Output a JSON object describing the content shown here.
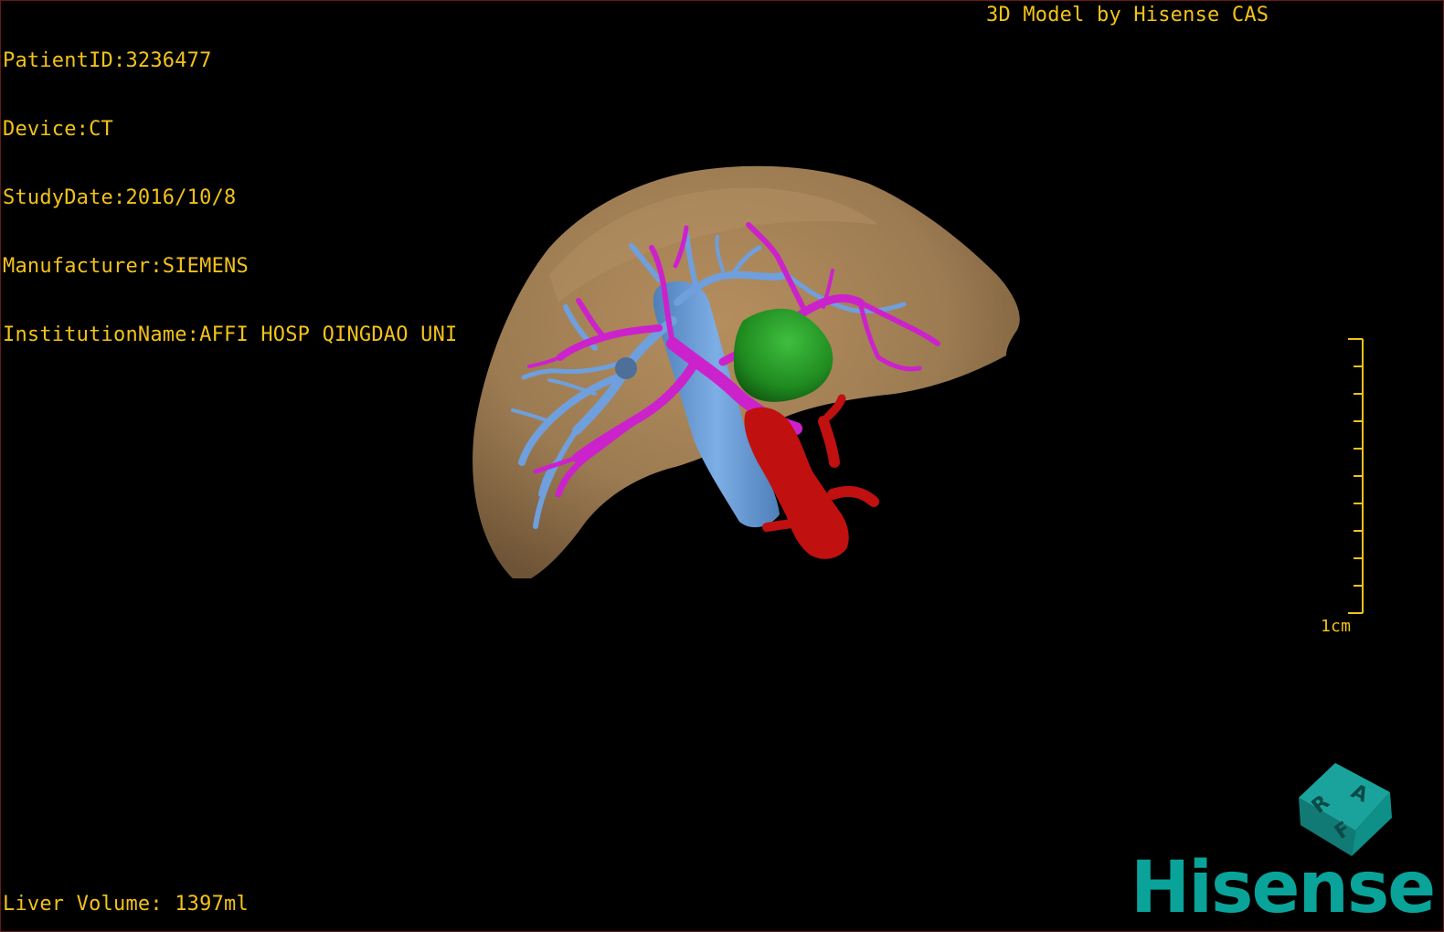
{
  "patient_info": {
    "patient_id": "PatientID:3236477",
    "device": "Device:CT",
    "study_date": "StudyDate:2016/10/8",
    "manufacturer": "Manufacturer:SIEMENS",
    "institution": "InstitutionName:AFFI HOSP QINGDAO UNI"
  },
  "model_credit": "3D Model by Hisense CAS",
  "liver_volume": "Liver Volume: 1397ml",
  "scale": {
    "label": "1cm"
  },
  "orientation_cube": {
    "faces": [
      "R",
      "A",
      "F"
    ]
  },
  "brand": "Hisense",
  "colors": {
    "overlay_text": "#f2c21a",
    "liver": "#9c7b52",
    "portal_vein": "#6f9fdc",
    "hepatic_vein": "#cc22cc",
    "tumor": "#1f8a1f",
    "artery": "#c01010",
    "brand": "#0aa39a"
  }
}
